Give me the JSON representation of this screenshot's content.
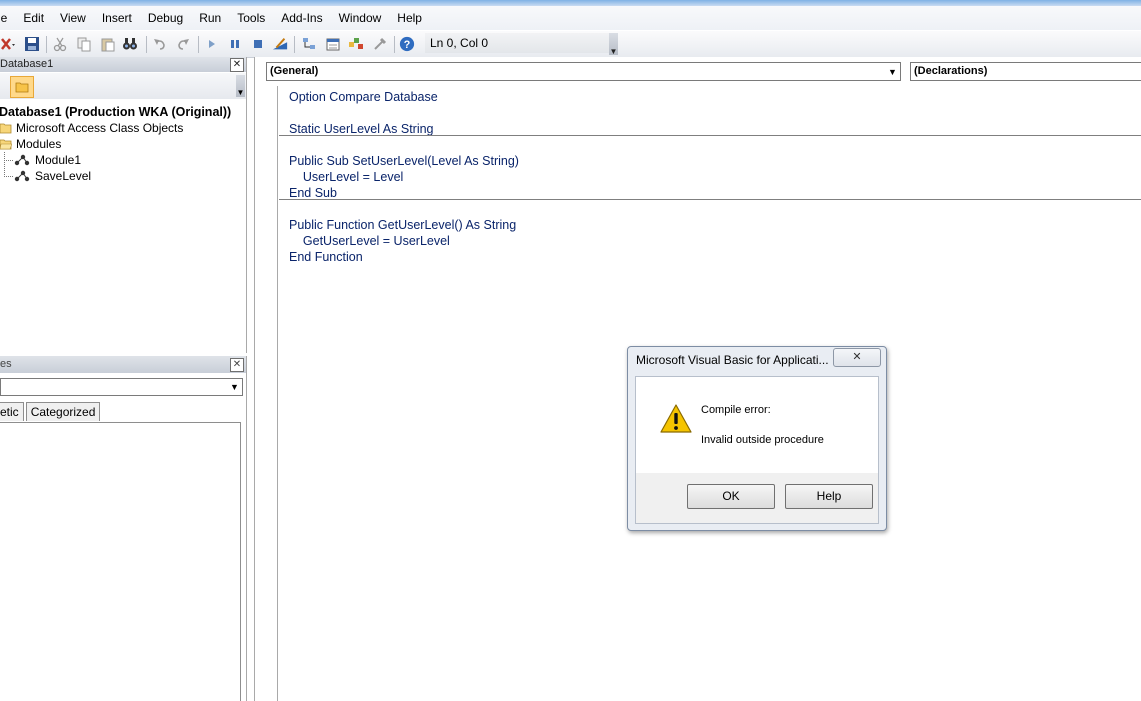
{
  "menu": [
    {
      "label": "le",
      "key": "file"
    },
    {
      "label": "Edit",
      "key": "edit"
    },
    {
      "label": "View",
      "key": "view"
    },
    {
      "label": "Insert",
      "key": "insert"
    },
    {
      "label": "Debug",
      "key": "debug"
    },
    {
      "label": "Run",
      "key": "run"
    },
    {
      "label": "Tools",
      "key": "tools"
    },
    {
      "label": "Add-Ins",
      "key": "add-ins"
    },
    {
      "label": "Window",
      "key": "window"
    },
    {
      "label": "Help",
      "key": "help"
    }
  ],
  "toolbar": {
    "position_label": "Ln 0, Col 0",
    "icons": [
      "view-access-icon",
      "save-icon",
      "cut-icon",
      "copy-icon",
      "paste-icon",
      "find-icon",
      "undo-icon",
      "redo-icon",
      "run-icon",
      "break-icon",
      "reset-icon",
      "design-mode-icon",
      "project-explorer-icon",
      "properties-icon",
      "object-browser-icon",
      "toolbox-icon",
      "help-icon"
    ]
  },
  "project": {
    "title": "Database1",
    "close_glyph": "✕",
    "tree": {
      "root": "Database1 (Production WKA (Original))",
      "class_objects": "Microsoft Access Class Objects",
      "modules": "Modules",
      "module_items": [
        "Module1",
        "SaveLevel"
      ]
    }
  },
  "properties": {
    "title": "es",
    "close_glyph": "✕",
    "tabs": [
      "etic",
      "Categorized"
    ]
  },
  "code": {
    "object_combo": "(General)",
    "procedure_combo": "(Declarations)",
    "lines": [
      "Option Compare Database",
      "",
      "Static UserLevel As String",
      "",
      "Public Sub SetUserLevel(Level As String)",
      "    UserLevel = Level",
      "End Sub",
      "",
      "Public Function GetUserLevel() As String",
      "    GetUserLevel = UserLevel",
      "End Function"
    ]
  },
  "dialog": {
    "title": "Microsoft Visual Basic for Applicati...",
    "close_glyph": "✕",
    "error_title": "Compile error:",
    "error_message": "Invalid outside procedure",
    "ok_label": "OK",
    "help_label": "Help"
  },
  "colors": {
    "code_text": "#0a246a",
    "warning_yellow": "#f5c400",
    "folder_yellow": "#ffd98a"
  }
}
